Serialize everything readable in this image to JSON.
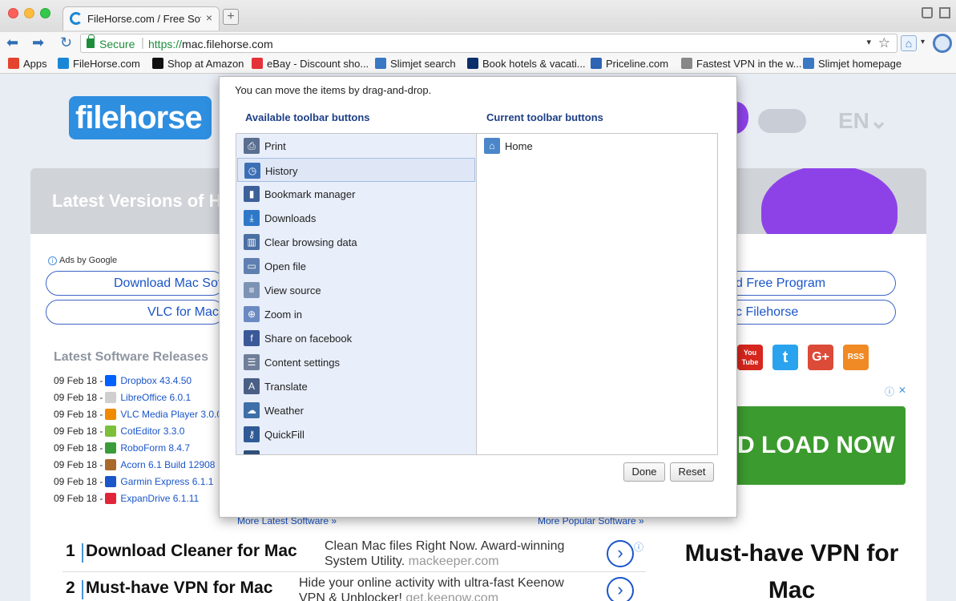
{
  "browser": {
    "tab_title": "FileHorse.com / Free Software Download",
    "tab_close": "×",
    "new_tab": "+",
    "back": "⬅",
    "forward": "➡",
    "reload": "↻",
    "secure_label": "Secure",
    "url_separator": "|",
    "url_scheme": "https://",
    "url_host": "mac.filehorse.com",
    "url_dropdown": "▾",
    "star": "☆",
    "home": "⌂",
    "menu_arrow": "▾"
  },
  "bookmarks": [
    {
      "label": "Apps",
      "color": "#e4442d"
    },
    {
      "label": "FileHorse.com",
      "color": "#1a87d6"
    },
    {
      "label": "Shop at Amazon",
      "color": "#111111"
    },
    {
      "label": "eBay - Discount sho...",
      "color": "#e53238"
    },
    {
      "label": "Slimjet search",
      "color": "#3b78c4"
    },
    {
      "label": "Book hotels & vacati...",
      "color": "#0b2f6b"
    },
    {
      "label": "Priceline.com",
      "color": "#2f64b4"
    },
    {
      "label": "Fastest VPN in the w...",
      "color": "#888888"
    },
    {
      "label": "Slimjet homepage",
      "color": "#3b78c4"
    }
  ],
  "site": {
    "logo_text": "filehorse",
    "language": "EN⌄",
    "hero_title": "Latest Versions of H",
    "ads_by_google": "Ads by Google",
    "ad_pills": [
      {
        "text": "Download Mac Sof"
      },
      {
        "text": "VLC for Mac"
      },
      {
        "text": "d Free Program"
      },
      {
        "text": "c Filehorse"
      }
    ],
    "latest_heading": "Latest Software Releases",
    "releases": [
      {
        "date": "09 Feb 18 -",
        "name": "Dropbox 43.4.50",
        "color": "#0061fe"
      },
      {
        "date": "09 Feb 18 -",
        "name": "LibreOffice 6.0.1",
        "color": "#cfcfcf"
      },
      {
        "date": "09 Feb 18 -",
        "name": "VLC Media Player 3.0.0",
        "color": "#f08a00"
      },
      {
        "date": "09 Feb 18 -",
        "name": "CotEditor 3.3.0",
        "color": "#7cbf3a"
      },
      {
        "date": "09 Feb 18 -",
        "name": "RoboForm 8.4.7",
        "color": "#3a9b3a"
      },
      {
        "date": "09 Feb 18 -",
        "name": "Acorn 6.1 Build 12908",
        "color": "#a8692b"
      },
      {
        "date": "09 Feb 18 -",
        "name": "Garmin Express 6.1.1",
        "color": "#1a55c9"
      },
      {
        "date": "09 Feb 18 -",
        "name": "ExpanDrive 6.1.11",
        "color": "#e0253a"
      }
    ],
    "more_latest": "More Latest Software »",
    "more_popular": "More Popular Software »",
    "social": [
      {
        "label": "You Tube",
        "color": "#d6261d"
      },
      {
        "label": "t",
        "color": "#2aa3ef"
      },
      {
        "label": "G+",
        "color": "#dc4a38"
      },
      {
        "label": "RSS",
        "color": "#f08a24"
      }
    ],
    "ad_info": "ⓘ",
    "ad_close": "✕",
    "download_banner": "D LOAD NOW",
    "list_ads": [
      {
        "num": "1",
        "title": "Download Cleaner for Mac",
        "desc": "Clean Mac files Right Now. Award-winning System Utility.",
        "domain": "mackeeper.com"
      },
      {
        "num": "2",
        "title": "Must-have VPN for Mac",
        "desc": "Hide your online activity with ultra-fast Keenow VPN & Unblocker!",
        "domain": "get.keenow.com"
      }
    ],
    "list_go": "›",
    "vpn_ad": "Must-have VPN for Mac"
  },
  "dialog": {
    "hint": "You can move the items by drag-and-drop.",
    "available_heading": "Available toolbar buttons",
    "current_heading": "Current toolbar buttons",
    "available": [
      {
        "label": "Print",
        "icon": "printer-icon",
        "glyph": "⎙",
        "color": "#5a6f8f"
      },
      {
        "label": "History",
        "icon": "clock-icon",
        "glyph": "◷",
        "color": "#3d6fb6"
      },
      {
        "label": "Bookmark manager",
        "icon": "bookmark-icon",
        "glyph": "▮",
        "color": "#3d5f9a"
      },
      {
        "label": "Downloads",
        "icon": "download-icon",
        "glyph": "⤓",
        "color": "#2f78c8"
      },
      {
        "label": "Clear browsing data",
        "icon": "trash-icon",
        "glyph": "▥",
        "color": "#4a6fa3"
      },
      {
        "label": "Open file",
        "icon": "folder-icon",
        "glyph": "▭",
        "color": "#5f7fb0"
      },
      {
        "label": "View source",
        "icon": "source-icon",
        "glyph": "≡",
        "color": "#7d93b5"
      },
      {
        "label": "Zoom in",
        "icon": "zoom-in-icon",
        "glyph": "⊕",
        "color": "#6b8ac2"
      },
      {
        "label": "Share on facebook",
        "icon": "facebook-icon",
        "glyph": "f",
        "color": "#3b5998"
      },
      {
        "label": "Content settings",
        "icon": "content-settings-icon",
        "glyph": "☰",
        "color": "#6f7f99"
      },
      {
        "label": "Translate",
        "icon": "translate-icon",
        "glyph": "A",
        "color": "#4a5f86"
      },
      {
        "label": "Weather",
        "icon": "weather-icon",
        "glyph": "☁",
        "color": "#3e6fa8"
      },
      {
        "label": "QuickFill",
        "icon": "key-icon",
        "glyph": "⚷",
        "color": "#2f5a96"
      },
      {
        "label": "",
        "icon": "more-icon",
        "glyph": "✱",
        "color": "#2f4f7a"
      }
    ],
    "current": [
      {
        "label": "Home",
        "icon": "home-icon",
        "glyph": "⌂",
        "color": "#4b86c9"
      }
    ],
    "done_label": "Done",
    "reset_label": "Reset"
  }
}
